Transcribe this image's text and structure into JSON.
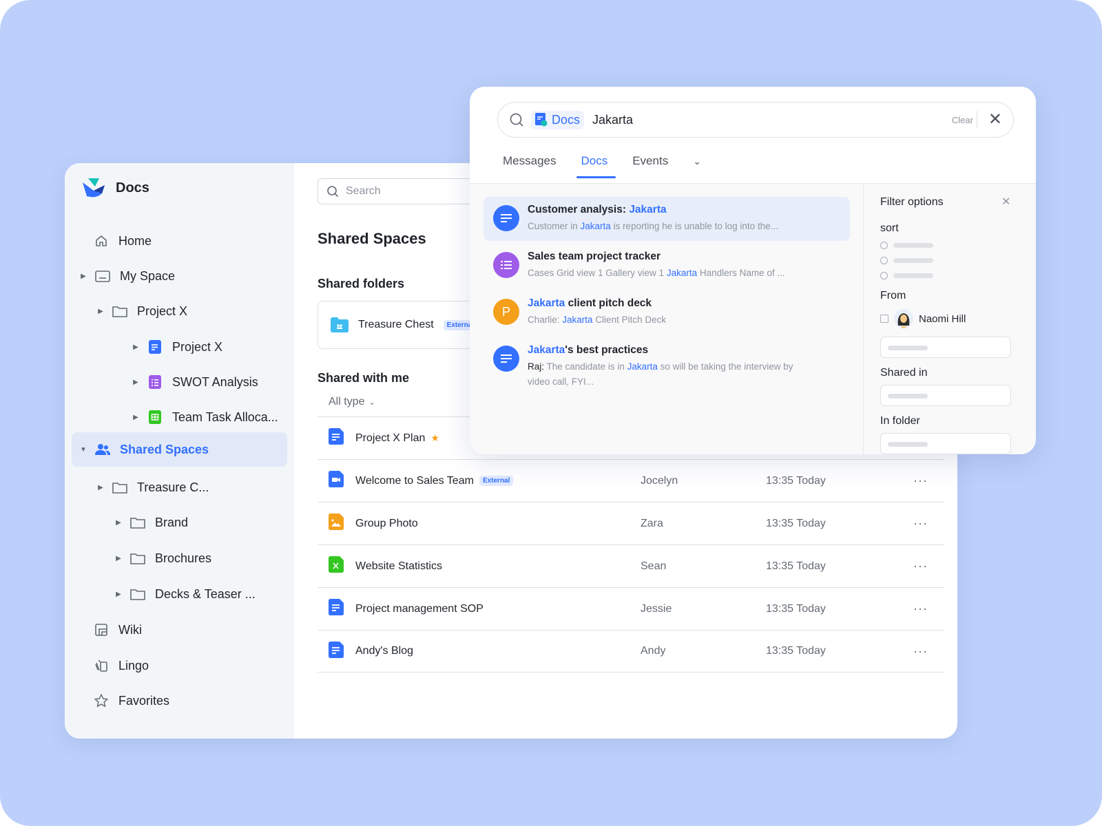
{
  "app": {
    "title": "Docs"
  },
  "sidebar": {
    "items": [
      {
        "label": "Home",
        "icon": "home-icon"
      },
      {
        "label": "My Space",
        "icon": "folder-icon"
      },
      {
        "label": "Project X",
        "icon": "folder-icon"
      },
      {
        "label": "Project X",
        "icon": "doc-icon"
      },
      {
        "label": "SWOT Analysis",
        "icon": "list-doc-icon"
      },
      {
        "label": "Team Task Alloca...",
        "icon": "sheet-icon"
      },
      {
        "label": "Shared Spaces",
        "icon": "people-icon"
      },
      {
        "label": "Treasure C...",
        "icon": "folder-icon"
      },
      {
        "label": "Brand",
        "icon": "folder-icon"
      },
      {
        "label": "Brochures",
        "icon": "folder-icon"
      },
      {
        "label": "Decks & Teaser ...",
        "icon": "folder-icon"
      },
      {
        "label": "Wiki",
        "icon": "wiki-icon"
      },
      {
        "label": "Lingo",
        "icon": "lingo-icon"
      },
      {
        "label": "Favorites",
        "icon": "star-icon"
      }
    ],
    "active": "Shared Spaces"
  },
  "main": {
    "search_placeholder": "Search",
    "title": "Shared Spaces",
    "shared_folders_heading": "Shared folders",
    "folder": {
      "name": "Treasure Chest",
      "badge": "Externa"
    },
    "shared_with_me_heading": "Shared with me",
    "type_filter": "All type",
    "rows": [
      {
        "name": "Project X Plan",
        "type": "doc",
        "starred": true,
        "badge": "",
        "owner": "",
        "time": ""
      },
      {
        "name": "Welcome to Sales Team",
        "type": "video",
        "starred": false,
        "badge": "External",
        "owner": "Jocelyn",
        "time": "13:35 Today"
      },
      {
        "name": "Group Photo",
        "type": "image",
        "starred": false,
        "badge": "",
        "owner": "Zara",
        "time": "13:35 Today"
      },
      {
        "name": "Website Statistics",
        "type": "excel",
        "starred": false,
        "badge": "",
        "owner": "Sean",
        "time": "13:35 Today"
      },
      {
        "name": "Project management SOP",
        "type": "doc",
        "starred": false,
        "badge": "",
        "owner": "Jessie",
        "time": "13:35 Today"
      },
      {
        "name": "Andy's Blog",
        "type": "doc",
        "starred": false,
        "badge": "",
        "owner": "Andy",
        "time": "13:35 Today"
      }
    ]
  },
  "overlay": {
    "scope": "Docs",
    "query": "Jakarta",
    "clear_label": "Clear",
    "tabs": [
      "Messages",
      "Docs",
      "Events"
    ],
    "active_tab": "Docs",
    "results": [
      {
        "title_pre": "Customer analysis: ",
        "title_hl": "Jakarta",
        "title_post": "",
        "snip_pre": "Customer in ",
        "snip_hl": "Jakarta",
        "snip_post": " is reporting he is unable to log into the...",
        "avatar": "doc",
        "color": "#3370ff"
      },
      {
        "title_pre": "Sales team project tracker",
        "title_hl": "",
        "title_post": "",
        "snip_pre": "Cases Grid view 1 Gallery view 1 ",
        "snip_hl": "Jakarta",
        "snip_post": " Handlers Name of ...",
        "avatar": "list",
        "color": "#9f5ce8"
      },
      {
        "title_pre": "",
        "title_hl": "Jakarta",
        "title_post": " client pitch deck",
        "snip_author": "Charlie: ",
        "snip_hl": "Jakarta",
        "snip_post": " Client Pitch Deck",
        "avatar": "P",
        "color": "#f5a01a"
      },
      {
        "title_pre": "",
        "title_hl": "Jakarta",
        "title_post": "'s best practices",
        "snip_author": "Raj: ",
        "snip_pre": "The candidate is in ",
        "snip_hl": "Jakarta",
        "snip_post": " so will be taking the interview by video call, FYI...",
        "avatar": "doc",
        "color": "#3370ff"
      }
    ],
    "filter": {
      "title": "Filter options",
      "sort_label": "sort",
      "from_label": "From",
      "from_person": "Naomi Hill",
      "shared_in_label": "Shared in",
      "in_folder_label": "In folder"
    }
  },
  "colors": {
    "accent": "#3370ff",
    "background": "#bdd0fb"
  }
}
